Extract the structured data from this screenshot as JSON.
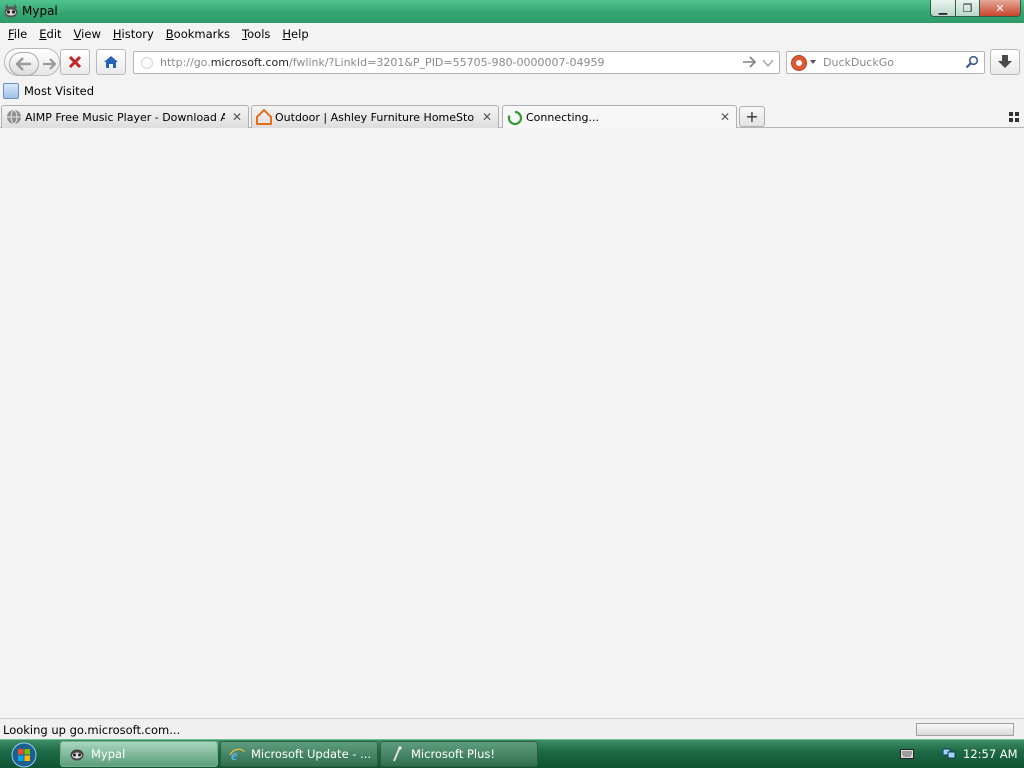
{
  "window": {
    "title": "Mypal",
    "close_glyph": "✕",
    "min_glyph": "▁",
    "max_glyph": "❐"
  },
  "menu": {
    "items": [
      {
        "key": "F",
        "rest": "ile"
      },
      {
        "key": "E",
        "rest": "dit"
      },
      {
        "key": "V",
        "rest": "iew"
      },
      {
        "key": "H",
        "rest": "istory"
      },
      {
        "key": "B",
        "rest": "ookmarks"
      },
      {
        "key": "T",
        "rest": "ools"
      },
      {
        "key": "H",
        "rest": "elp"
      }
    ]
  },
  "navbar": {
    "url_prefix": "http://go.",
    "url_domain": "microsoft.com",
    "url_suffix": "/fwlink/?LinkId=3201&P_PID=55705-980-0000007-04959",
    "search_placeholder": "DuckDuckGo"
  },
  "bookmarks": {
    "items": [
      {
        "label": "Most Visited"
      }
    ]
  },
  "tabs": [
    {
      "label": "AIMP Free Music Player - Download AI...",
      "icon": "globe-icon",
      "active": false
    },
    {
      "label": "Outdoor | Ashley Furniture HomeStore",
      "icon": "ashley-home-icon",
      "active": false
    },
    {
      "label": "Connecting...",
      "icon": "loading-spinner-icon",
      "active": true
    }
  ],
  "newtab_glyph": "+",
  "status": {
    "text": "Looking up go.microsoft.com..."
  },
  "taskbar": {
    "buttons": [
      {
        "label": "Mypal",
        "icon": "mypal-icon",
        "active": true
      },
      {
        "label": "Microsoft Update - ...",
        "icon": "ie-icon",
        "active": false
      },
      {
        "label": "Microsoft Plus!",
        "icon": "microsoft-plus-icon",
        "active": false
      }
    ],
    "clock": "12:57 AM"
  },
  "colors": {
    "titlebar": "#35a673",
    "taskbar": "#1e6a46",
    "chrome_bg": "#f3f3f3",
    "stop_red": "#c32222",
    "home_blue": "#2a62b8"
  }
}
